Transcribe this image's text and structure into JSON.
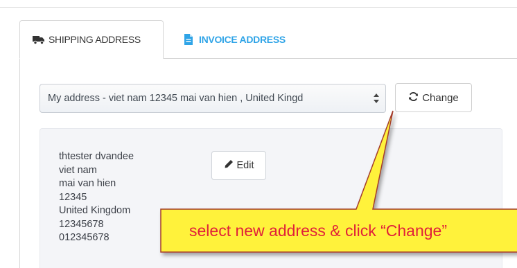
{
  "tabs": [
    {
      "label": "SHIPPING ADDRESS",
      "icon": "truck-icon",
      "active": true
    },
    {
      "label": "INVOICE ADDRESS",
      "icon": "document-icon",
      "active": false
    }
  ],
  "address_select": {
    "selected": "My address - viet nam 12345 mai van hien , United Kingd"
  },
  "change_button": {
    "label": "Change",
    "icon": "refresh-icon"
  },
  "address_card": {
    "lines": [
      "thtester dvandee",
      "viet nam",
      "mai van hien",
      "12345",
      "United Kingdom",
      "12345678",
      "012345678"
    ],
    "edit_label": "Edit",
    "edit_icon": "pencil-icon"
  },
  "callout": {
    "text": "select new address & click “Change”"
  },
  "colors": {
    "accent": "#2fa4e7",
    "callout_fill": "#fff23a",
    "callout_text": "#e0203a",
    "callout_border": "#a43c2c"
  }
}
